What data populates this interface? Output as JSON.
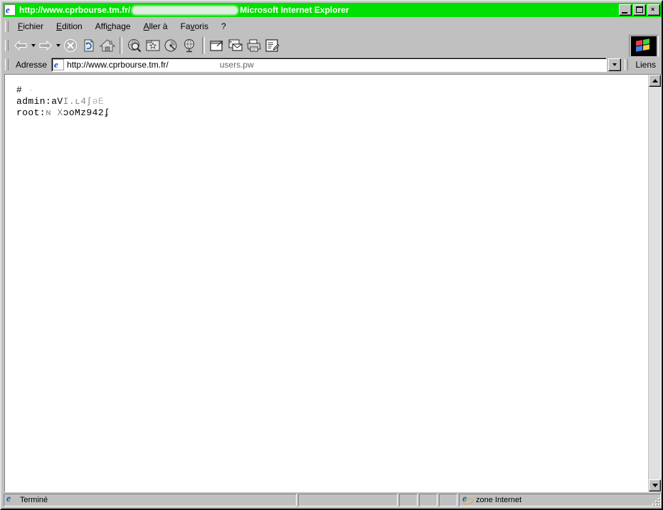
{
  "window": {
    "title_prefix": "http://www.cprbourse.tm.fr/",
    "title_suffix": "Microsoft Internet Explorer",
    "titlebar_color": "#00e000",
    "icon": "ie-document-icon",
    "buttons": {
      "minimize": "_",
      "maximize": "□",
      "close": "×"
    }
  },
  "menu": {
    "items": [
      {
        "label": "Fichier",
        "accel": "F"
      },
      {
        "label": "Edition",
        "accel": "E"
      },
      {
        "label": "Affichage",
        "accel": "c"
      },
      {
        "label": "Aller à",
        "accel": "A"
      },
      {
        "label": "Favoris",
        "accel": "v"
      },
      {
        "label": "?",
        "accel": ""
      }
    ]
  },
  "toolbar": {
    "buttons": [
      {
        "name": "back-button",
        "icon": "arrow-left-icon",
        "has_dropdown": true,
        "disabled": false
      },
      {
        "name": "forward-button",
        "icon": "arrow-right-icon",
        "has_dropdown": true,
        "disabled": false
      },
      {
        "name": "stop-button",
        "icon": "stop-icon",
        "has_dropdown": false,
        "disabled": true
      },
      {
        "name": "refresh-button",
        "icon": "refresh-icon",
        "has_dropdown": false,
        "disabled": false
      },
      {
        "name": "home-button",
        "icon": "home-icon",
        "has_dropdown": false,
        "disabled": false
      },
      {
        "name": "search-button",
        "icon": "search-globe-icon",
        "has_dropdown": false,
        "disabled": false
      },
      {
        "name": "favorites-button",
        "icon": "favorites-folder-icon",
        "has_dropdown": false,
        "disabled": false
      },
      {
        "name": "channels-button",
        "icon": "channels-disc-icon",
        "has_dropdown": false,
        "disabled": false
      },
      {
        "name": "history-button",
        "icon": "history-globe-icon",
        "has_dropdown": false,
        "disabled": false
      },
      {
        "name": "fullscreen-button",
        "icon": "fullscreen-icon",
        "has_dropdown": false,
        "disabled": false
      },
      {
        "name": "mail-button",
        "icon": "mail-icon",
        "has_dropdown": false,
        "disabled": false
      },
      {
        "name": "print-button",
        "icon": "printer-icon",
        "has_dropdown": false,
        "disabled": false
      },
      {
        "name": "edit-button",
        "icon": "edit-page-icon",
        "has_dropdown": false,
        "disabled": false
      }
    ],
    "animation_logo": "windows-flag-icon"
  },
  "address": {
    "label": "Adresse",
    "icon": "ie-page-icon",
    "value_visible": "http://www.cprbourse.tm.fr/",
    "value_tail": "users.pw",
    "redacted": true,
    "dropdown_icon": "chevron-down-icon",
    "links_label": "Liens"
  },
  "page": {
    "lines": [
      {
        "text": "#",
        "faded": false
      },
      {
        "text": "admin:aV  I.ʟ4ʃ    ǝF",
        "faded": false
      },
      {
        "text": "root:ɴ X    ɔoMз942ɔ",
        "faded": false
      }
    ],
    "line1_main": "#",
    "line2_user": "admin:",
    "line2_hash": "aV",
    "line2_hash_b": "I.ʟ4ʃ",
    "line2_hash_c": "ǝE",
    "line3_user": "root:",
    "line3_hash": "ɴ X",
    "line3_hash_b": "ɔoMz942ʄ",
    "background": "#ffffff"
  },
  "scrollbar": {
    "up_icon": "scroll-up-arrow-icon",
    "down_icon": "scroll-down-arrow-icon",
    "orientation": "vertical"
  },
  "statusbar": {
    "status_icon": "ie-document-icon",
    "status_text": "Terminé",
    "zone_icon": "ie-globe-icon",
    "zone_text": "zone Internet",
    "resize_grip": "resize-grip-icon"
  }
}
